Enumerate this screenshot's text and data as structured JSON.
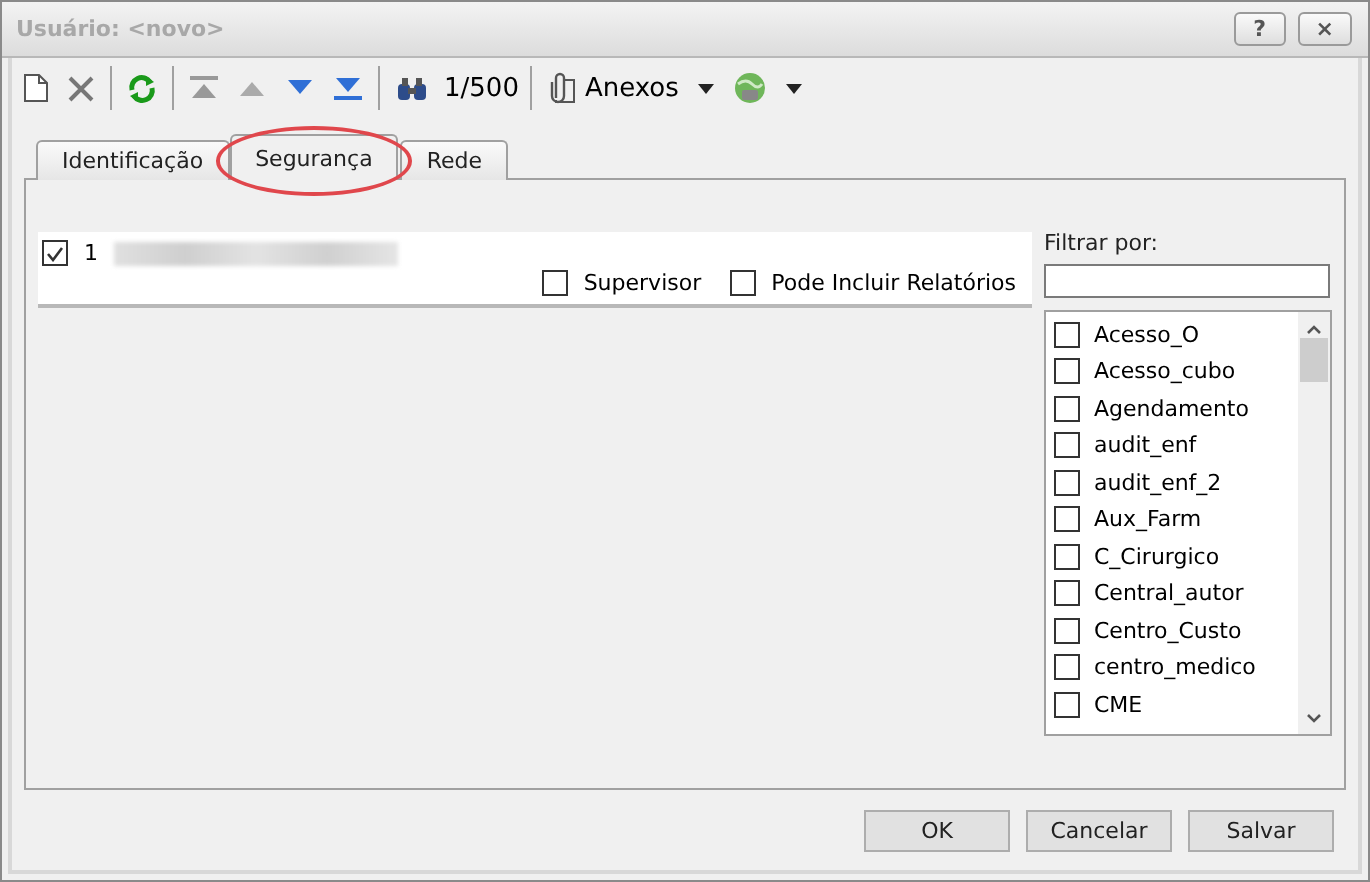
{
  "window": {
    "title": "Usuário: <novo>",
    "help_button": "?",
    "close_button": "×"
  },
  "toolbar": {
    "record_counter": "1/500",
    "attachments_label": "Anexos"
  },
  "tabs": [
    {
      "label": "Identificação",
      "selected": false,
      "highlighted": false
    },
    {
      "label": "Segurança",
      "selected": true,
      "highlighted": true
    },
    {
      "label": "Rede",
      "selected": false,
      "highlighted": false
    }
  ],
  "user_row": {
    "checked": true,
    "number": "1"
  },
  "options": [
    {
      "label": "Supervisor",
      "checked": false
    },
    {
      "label": "Pode Incluir Relatórios",
      "checked": false
    }
  ],
  "filter": {
    "label": "Filtrar por:",
    "items": [
      {
        "label": "Acesso_O",
        "checked": false
      },
      {
        "label": "Acesso_cubo",
        "checked": false
      },
      {
        "label": "Agendamento",
        "checked": false
      },
      {
        "label": "audit_enf",
        "checked": false
      },
      {
        "label": "audit_enf_2",
        "checked": false
      },
      {
        "label": "Aux_Farm",
        "checked": false
      },
      {
        "label": "C_Cirurgico",
        "checked": false
      },
      {
        "label": "Central_autor",
        "checked": false
      },
      {
        "label": "Centro_Custo",
        "checked": false
      },
      {
        "label": "centro_medico",
        "checked": false
      },
      {
        "label": "CME",
        "checked": false
      }
    ]
  },
  "buttons": [
    "OK",
    "Cancelar",
    "Salvar"
  ]
}
